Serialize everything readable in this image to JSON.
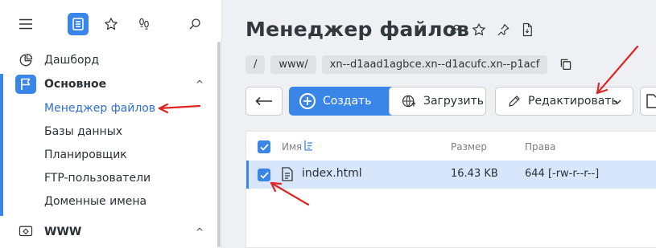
{
  "sidebar": {
    "top_icons": [
      "menu-icon",
      "file-list-icon",
      "star-icon",
      "footprints-icon",
      "search-icon"
    ],
    "items": [
      {
        "label": "Дашборд",
        "icon": "pie-chart-icon"
      },
      {
        "label": "Основное",
        "icon": "flag-icon",
        "chevron": "^"
      },
      {
        "label": "Менеджер файлов"
      },
      {
        "label": "Базы данных"
      },
      {
        "label": "Планировщик"
      },
      {
        "label": "FTP-пользователи"
      },
      {
        "label": "Доменные имена"
      },
      {
        "label": "WWW",
        "icon": "www-gear-icon",
        "chevron": "^"
      }
    ]
  },
  "header": {
    "title": "Менеджер файлов",
    "icons": [
      "link-icon",
      "star-icon",
      "pin-icon",
      "document-icon"
    ]
  },
  "breadcrumb": [
    "/",
    "www/",
    "xn--d1aad1agbce.xn--d1acufc.xn--p1acf"
  ],
  "toolbar": {
    "create": "Создать",
    "upload": "Загрузить",
    "edit": "Редактировать"
  },
  "table": {
    "headers": {
      "name": "Имя",
      "size": "Размер",
      "perms": "Права"
    },
    "rows": [
      {
        "name": "index.html",
        "size": "16.43 KB",
        "perms": "644 [-rw-r--r--]"
      }
    ]
  },
  "colors": {
    "accent": "#3a86e8",
    "arrow": "#e02424",
    "row_selected": "#d7e6fb"
  }
}
